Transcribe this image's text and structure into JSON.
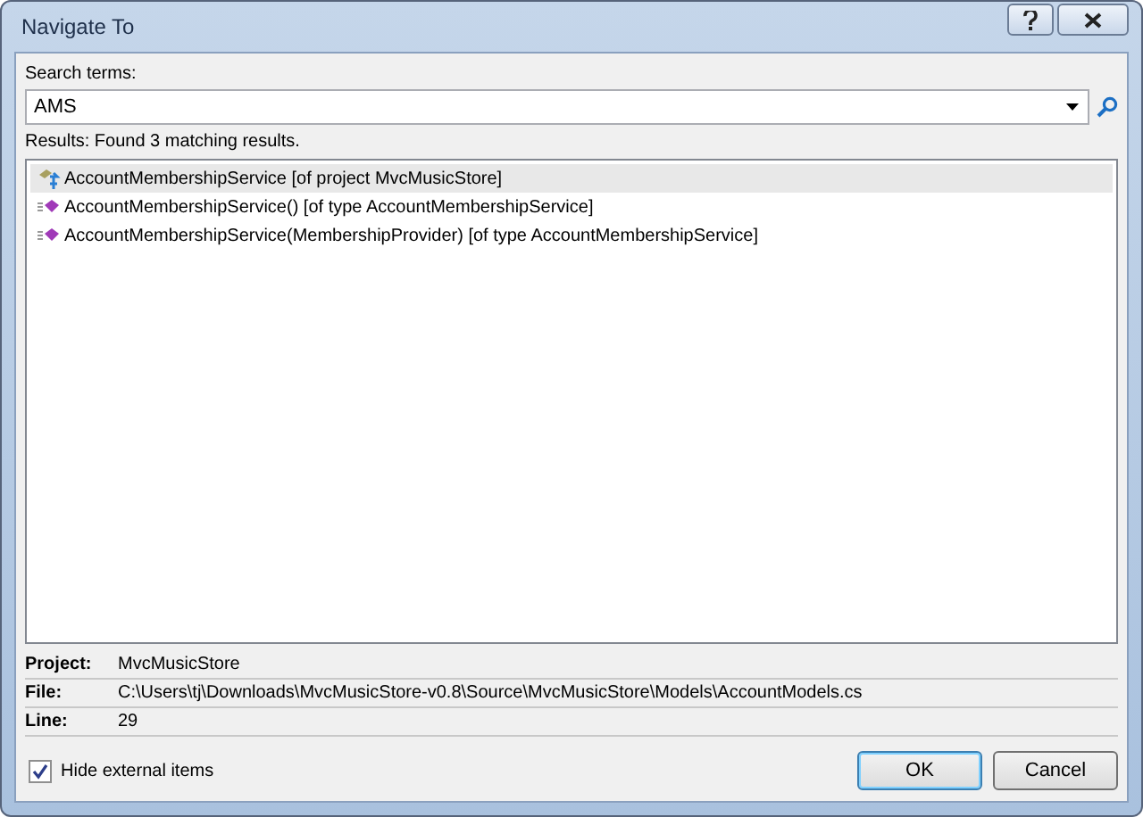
{
  "window": {
    "title": "Navigate To"
  },
  "search": {
    "label": "Search terms:",
    "value": "AMS"
  },
  "results_label": "Results: Found 3 matching results.",
  "results": [
    {
      "kind": "project",
      "text": "AccountMembershipService [of project MvcMusicStore]",
      "selected": true
    },
    {
      "kind": "method",
      "text": "AccountMembershipService() [of type AccountMembershipService]",
      "selected": false
    },
    {
      "kind": "method",
      "text": "AccountMembershipService(MembershipProvider) [of type AccountMembershipService]",
      "selected": false
    }
  ],
  "details": [
    {
      "label": "Project:",
      "value": "MvcMusicStore"
    },
    {
      "label": "File:",
      "value": "C:\\Users\\tj\\Downloads\\MvcMusicStore-v0.8\\Source\\MvcMusicStore\\Models\\AccountModels.cs"
    },
    {
      "label": "Line:",
      "value": "29"
    }
  ],
  "hide_external": {
    "label": "Hide external items",
    "checked": true
  },
  "buttons": [
    {
      "label": "OK",
      "default": true
    },
    {
      "label": "Cancel",
      "default": false
    }
  ]
}
